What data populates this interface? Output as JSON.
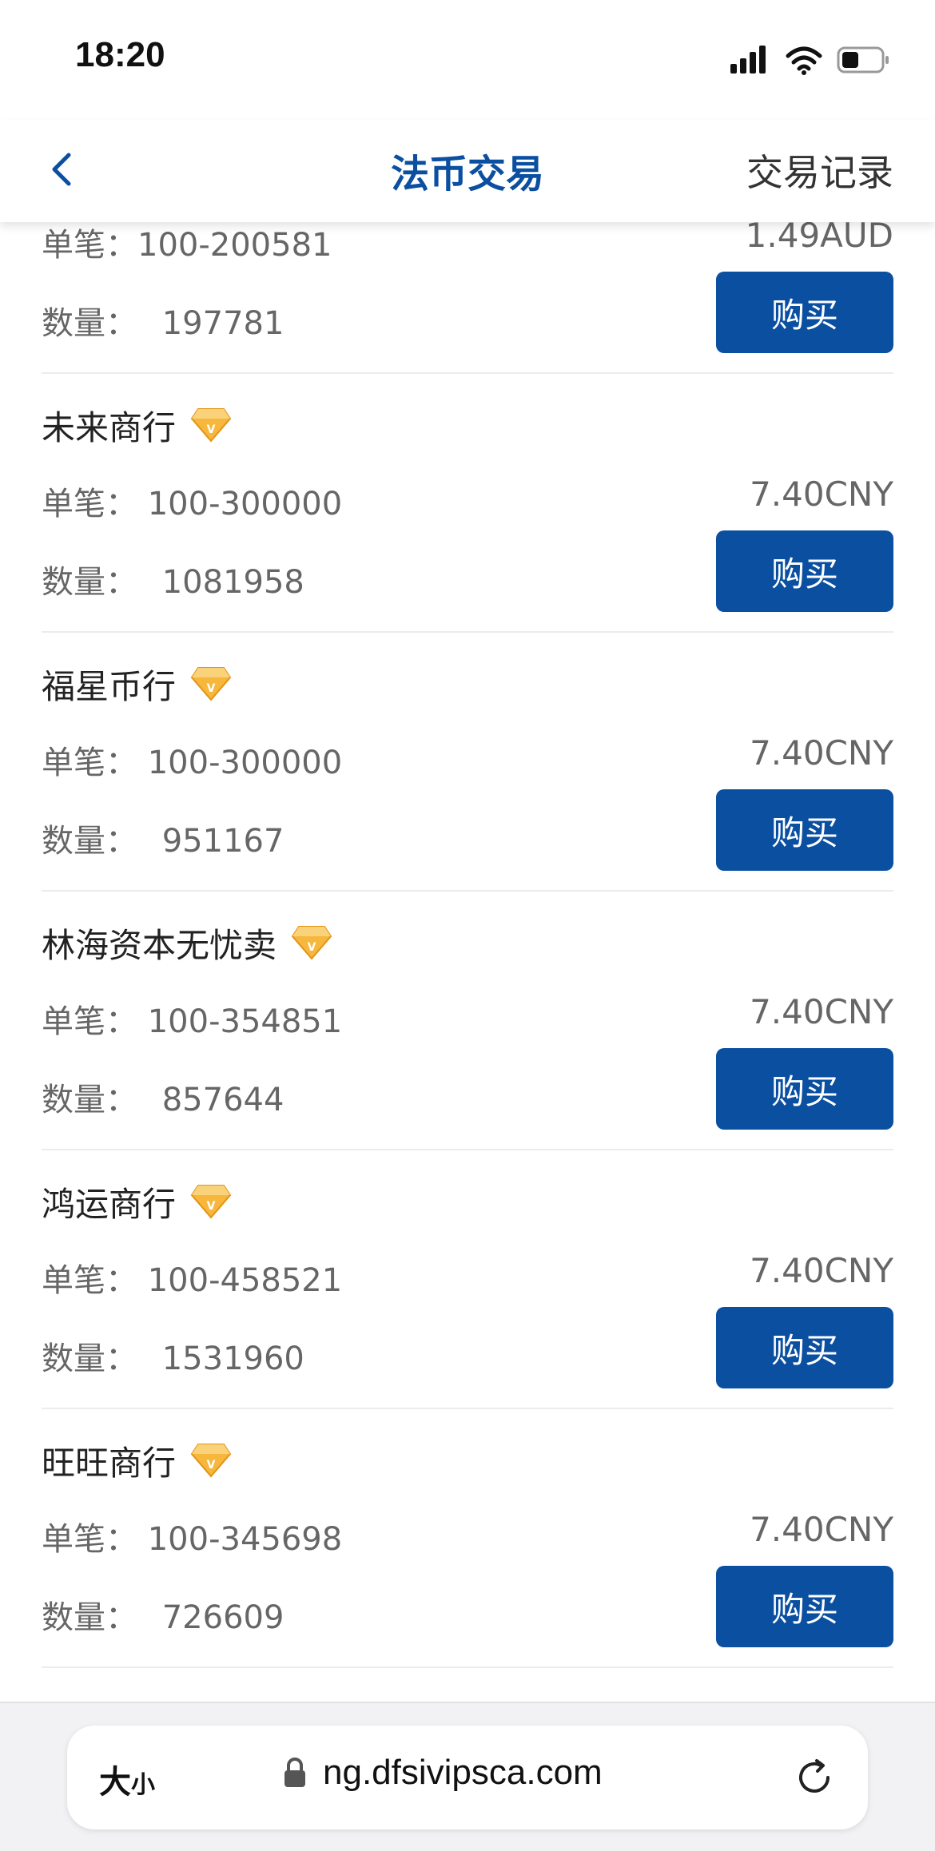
{
  "status_bar": {
    "time": "18:20"
  },
  "nav": {
    "title": "法币交易",
    "records": "交易记录"
  },
  "partial_listing": {
    "limit": "单笔：100-200581",
    "price": "1.49AUD",
    "qty_label": "数量：",
    "qty_value": "197781",
    "buy_label": "购买"
  },
  "listings": [
    {
      "name": "未来商行",
      "limit_label": "单笔：",
      "limit_value": "100-300000",
      "qty_label": "数量：",
      "qty_value": "1081958",
      "price": "7.40CNY",
      "buy_label": "购买"
    },
    {
      "name": "福星币行",
      "limit_label": "单笔：",
      "limit_value": "100-300000",
      "qty_label": "数量：",
      "qty_value": "951167",
      "price": "7.40CNY",
      "buy_label": "购买"
    },
    {
      "name": "林海资本无忧卖",
      "limit_label": "单笔：",
      "limit_value": "100-354851",
      "qty_label": "数量：",
      "qty_value": "857644",
      "price": "7.40CNY",
      "buy_label": "购买"
    },
    {
      "name": "鸿运商行",
      "limit_label": "单笔：",
      "limit_value": "100-458521",
      "qty_label": "数量：",
      "qty_value": "1531960",
      "price": "7.40CNY",
      "buy_label": "购买"
    },
    {
      "name": "旺旺商行",
      "limit_label": "单笔：",
      "limit_value": "100-345698",
      "qty_label": "数量：",
      "qty_value": "726609",
      "price": "7.40CNY",
      "buy_label": "购买"
    }
  ],
  "browser": {
    "text_size_big": "大",
    "text_size_small": "小",
    "url": "ng.dfsivipsca.com"
  },
  "icons": {
    "signal": "cellular-signal-icon",
    "wifi": "wifi-icon",
    "battery": "battery-icon",
    "back": "chevron-left-icon",
    "vip": "diamond-vip-icon",
    "lock": "lock-icon",
    "reload": "reload-icon"
  },
  "colors": {
    "accent": "#0b4fa1",
    "vip_badge": "#f0a020",
    "text_muted": "#666666"
  }
}
